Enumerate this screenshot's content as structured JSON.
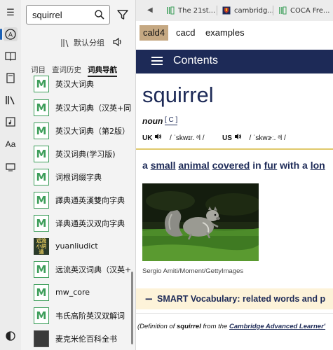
{
  "search": {
    "value": "squirrel"
  },
  "group": {
    "label": "默认分组"
  },
  "tabs": [
    "词目",
    "查词历史",
    "词典导航"
  ],
  "dictionaries": [
    {
      "label": "英汉大词典",
      "icon": "m-dict-icon"
    },
    {
      "label": "英汉大词典（汉英+同",
      "icon": "m-dict-icon"
    },
    {
      "label": "英汉大词典（第2版）",
      "icon": "m-dict-icon"
    },
    {
      "label": "英汉词典(学习版)",
      "icon": "m-dict-icon"
    },
    {
      "label": "词根词缀字典",
      "icon": "m-dict-icon"
    },
    {
      "label": "譯典通英漢雙向字典",
      "icon": "m-dict-icon"
    },
    {
      "label": "译典通英汉双向字典",
      "icon": "m-dict-icon"
    },
    {
      "label": "yuanliudict",
      "icon": "yuanliu-logo-icon"
    },
    {
      "label": "远流英汉词典（汉英+",
      "icon": "m-dict-icon"
    },
    {
      "label": "mw_core",
      "icon": "m-dict-icon"
    },
    {
      "label": "韦氏高阶英汉双解词",
      "icon": "m-dict-icon"
    },
    {
      "label": "麦克米伦百科全书",
      "icon": "book-cover-icon"
    }
  ],
  "browser_tabs": [
    {
      "label": "The 21st..."
    },
    {
      "label": "cambridg..."
    },
    {
      "label": "COCA Fre..."
    }
  ],
  "dict_tabs": [
    "cald4",
    "cacd",
    "examples"
  ],
  "contents": {
    "label": "Contents"
  },
  "entry": {
    "headword": "squirrel",
    "pos": "noun",
    "grammar": "[ C ]",
    "uk_label": "UK",
    "uk_ipa": "/ ˈskwɪr. ᵊl /",
    "us_label": "US",
    "us_ipa": "/ ˈskwɝː. ᵊl /",
    "def_words": [
      "a",
      "small",
      "animal",
      "covered",
      "in",
      "fur",
      "with a",
      "lon"
    ],
    "photo_credit": "Sergio Amiti/Moment/GettyImages",
    "smart_vocab": "SMART Vocabulary: related words and p",
    "footer_prefix": "(Definition of",
    "footer_word": "squirrel",
    "footer_mid": "from the",
    "footer_source": "Cambridge Advanced Learner'"
  },
  "colors": {
    "navy": "#1d2a57",
    "accent_tab": "#c5a882",
    "dict_green": "#3d9e5a",
    "smart_bg": "#fdf3d9"
  }
}
